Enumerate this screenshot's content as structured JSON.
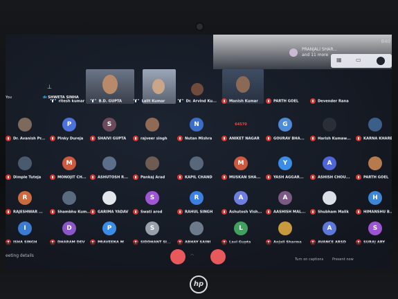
{
  "presenting": {
    "line1": "PRANJALI SHAR...",
    "line2": "and 11 more"
  },
  "clock": "840",
  "controls": {
    "meeting_details": "eeting details",
    "turn_on_captions": "Turn on captions",
    "present_now": "Present now"
  },
  "brand": "hp",
  "colors": {
    "mic_off": "#d9352e",
    "end_call": "#e8595b"
  },
  "pinned": {
    "you": "You",
    "shweta": "SHWETA SINHA"
  },
  "participants": [
    {
      "name": "ritesh kumar",
      "initial": "",
      "color": "#3a4a5e"
    },
    {
      "name": "B.D. GUPTA",
      "initial": "",
      "color": "#5b6a7d"
    },
    {
      "name": "Lalit Kumar",
      "initial": "",
      "color": "#704a3a"
    },
    {
      "name": "Dr. Arvind Ku...",
      "initial": "",
      "color": "#4b5d78"
    },
    {
      "name": "Manish Kumar",
      "initial": "M",
      "color": "#5965d8"
    },
    {
      "name": "PARTH GOEL",
      "initial": "",
      "color": "#c0794c"
    },
    {
      "name": "Devender Rana",
      "initial": "D",
      "color": "#8f49c4"
    },
    {
      "name": "Dr. Avanish Pr...",
      "initial": "",
      "color": "#7c6b5b"
    },
    {
      "name": "Pinky Dureja",
      "initial": "P",
      "color": "#4d72d9"
    },
    {
      "name": "SHAIVI GUPTA",
      "initial": "S",
      "color": "#6b4a5c"
    },
    {
      "name": "rajveer singh",
      "initial": "",
      "color": "#8f6a55"
    },
    {
      "name": "Nutan Mishra",
      "initial": "N",
      "color": "#3b6ec8"
    },
    {
      "name": "ANIKET NAGAR",
      "initial": "64570",
      "color": "#1b1e25"
    },
    {
      "name": "GOURAV BHA...",
      "initial": "G",
      "color": "#4b8bd8"
    },
    {
      "name": "Harish Kumaw...",
      "initial": "",
      "color": "#2a2e36"
    },
    {
      "name": "KARNA KHARE",
      "initial": "",
      "color": "#3c5f8a"
    },
    {
      "name": "Dimple Tuteja",
      "initial": "",
      "color": "#4a5a6e"
    },
    {
      "name": "MONOJIT CH...",
      "initial": "M",
      "color": "#cc5a3f"
    },
    {
      "name": "ASHUTOSH R...",
      "initial": "",
      "color": "#5b6f8a"
    },
    {
      "name": "Pankaj Arad",
      "initial": "",
      "color": "#6e5c52"
    },
    {
      "name": "KAPIL CHAND",
      "initial": "",
      "color": "#59677a"
    },
    {
      "name": "MUSKAN SHA...",
      "initial": "M",
      "color": "#cc5a3f"
    },
    {
      "name": "YASH AGGAR...",
      "initial": "Y",
      "color": "#3b8ce6"
    },
    {
      "name": "ASHISH CHOU...",
      "initial": "A",
      "color": "#4f66d6"
    },
    {
      "name": "PARTH GOEL",
      "initial": "",
      "color": "#b77a4c"
    },
    {
      "name": "RAJESHWAR ...",
      "initial": "R",
      "color": "#cc6a3f"
    },
    {
      "name": "Shambhu Kum...",
      "initial": "",
      "color": "#5a6b80"
    },
    {
      "name": "GARIMA YADAV",
      "initial": "",
      "color": "#e3e6ec"
    },
    {
      "name": "Swati arod",
      "initial": "S",
      "color": "#a055d2"
    },
    {
      "name": "RAHUL SINGH",
      "initial": "R",
      "color": "#3b7fe0"
    },
    {
      "name": "Ashutosh Vish...",
      "initial": "A",
      "color": "#6d7ee0"
    },
    {
      "name": "AASHISH MAL...",
      "initial": "A",
      "color": "#7a5a82"
    },
    {
      "name": "Shubham Malik",
      "initial": "",
      "color": "#dcdfe5"
    },
    {
      "name": "HIMANSHU B...",
      "initial": "H",
      "color": "#3d86d6"
    },
    {
      "name": "ISHA SINGH",
      "initial": "I",
      "color": "#3a7ad0"
    },
    {
      "name": "DHARAM DEV",
      "initial": "D",
      "color": "#8c55c8"
    },
    {
      "name": "PRAVEENA M",
      "initial": "P",
      "color": "#3b8ce6"
    },
    {
      "name": "SIDDHANT SI...",
      "initial": "S",
      "color": "#9aa0ab"
    },
    {
      "name": "ABHAY SAINI",
      "initial": "",
      "color": "#6c7a8c"
    },
    {
      "name": "Lavi Gupta",
      "initial": "L",
      "color": "#41a05e"
    },
    {
      "name": "Anjali Sharma",
      "initial": "",
      "color": "#c79a3e"
    },
    {
      "name": "AVANCE ARSD",
      "initial": "A",
      "color": "#5d78d8"
    },
    {
      "name": "SURAJ ARY",
      "initial": "S",
      "color": "#9b55d2"
    }
  ]
}
